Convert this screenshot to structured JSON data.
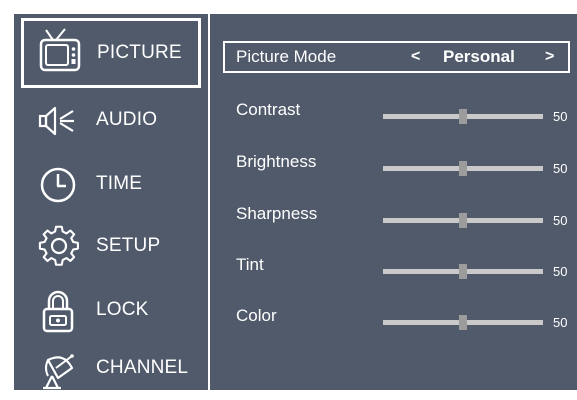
{
  "sidebar": {
    "items": [
      {
        "label": "PICTURE",
        "icon": "tv-icon",
        "selected": true
      },
      {
        "label": "AUDIO",
        "icon": "speaker-icon",
        "selected": false
      },
      {
        "label": "TIME",
        "icon": "clock-icon",
        "selected": false
      },
      {
        "label": "SETUP",
        "icon": "gear-icon",
        "selected": false
      },
      {
        "label": "LOCK",
        "icon": "lock-icon",
        "selected": false
      },
      {
        "label": "CHANNEL",
        "icon": "satellite-dish-icon",
        "selected": false
      }
    ]
  },
  "picture": {
    "mode": {
      "label": "Picture Mode",
      "value": "Personal",
      "left_arrow": "<",
      "right_arrow": ">"
    },
    "settings": [
      {
        "label": "Contrast",
        "value": "50",
        "level": 0.5
      },
      {
        "label": "Brightness",
        "value": "50",
        "level": 0.5
      },
      {
        "label": "Sharpness",
        "value": "50",
        "level": 0.5
      },
      {
        "label": "Tint",
        "value": "50",
        "level": 0.5
      },
      {
        "label": "Color",
        "value": "50",
        "level": 0.5
      }
    ]
  },
  "colors": {
    "background": "#505a6b",
    "text": "#ffffff",
    "slider_track": "#c9c9c9",
    "slider_thumb": "#9c9c9c"
  }
}
